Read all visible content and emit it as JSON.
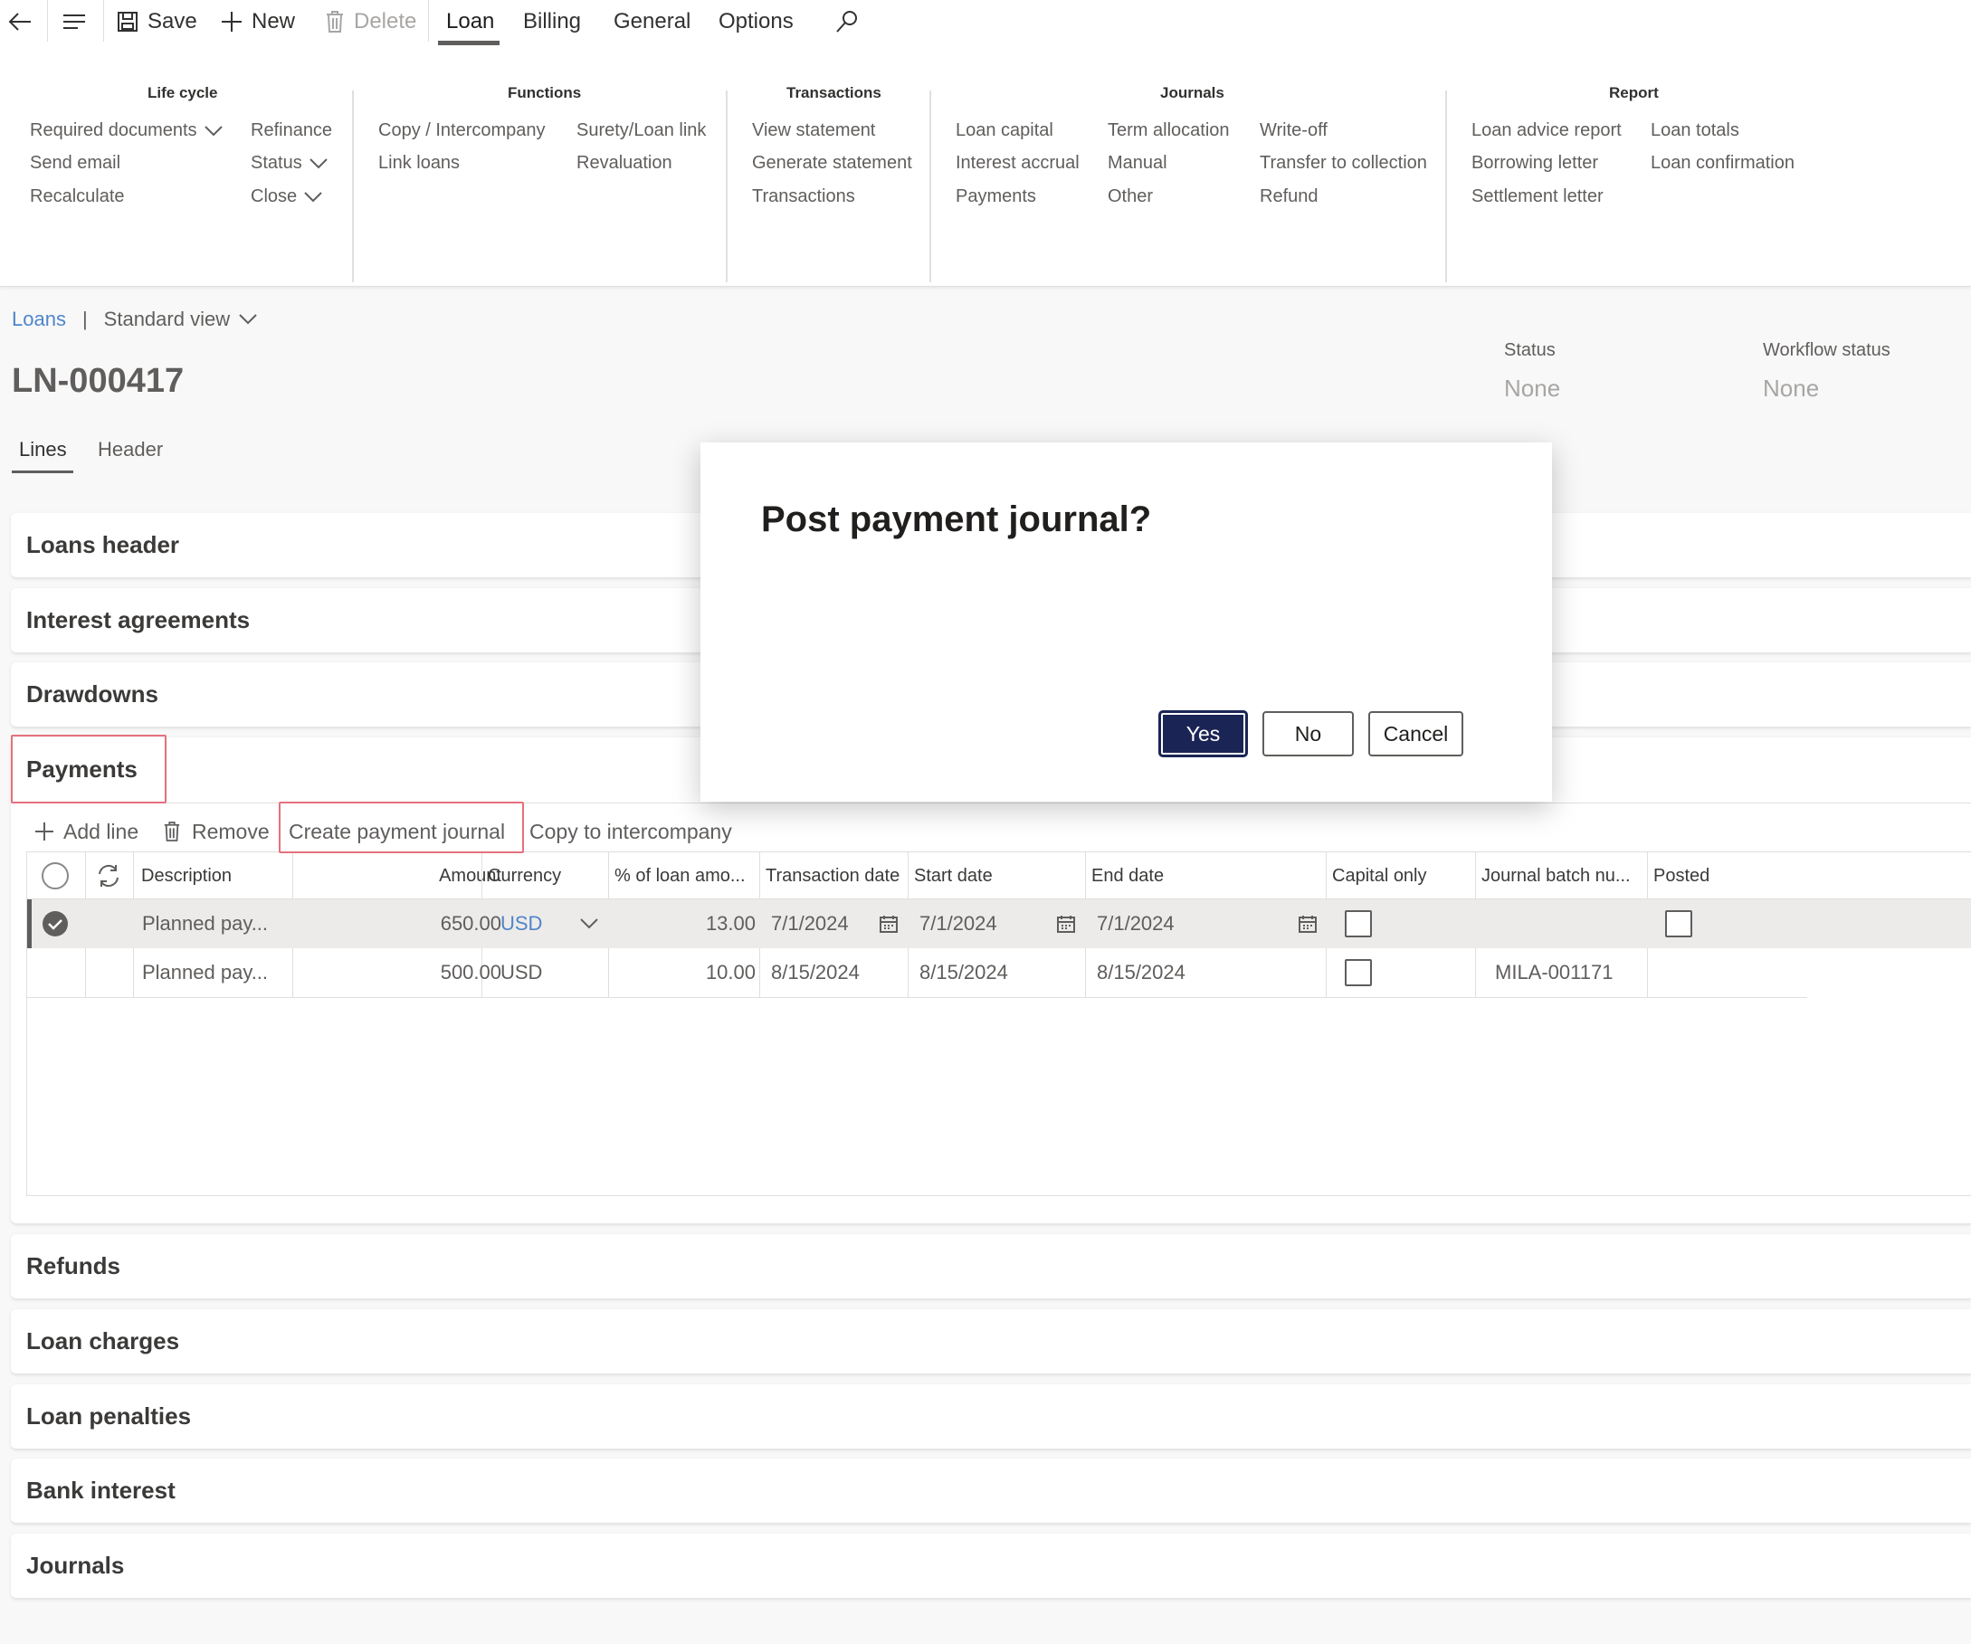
{
  "toolbar": {
    "save_label": "Save",
    "new_label": "New",
    "delete_label": "Delete",
    "tabs": [
      "Loan",
      "Billing",
      "General",
      "Options"
    ],
    "active_tab": "Loan"
  },
  "ribbon": {
    "groups": [
      {
        "title": "Life cycle",
        "items": [
          "Required documents",
          "Send email",
          "Recalculate",
          "Refinance",
          "Status",
          "Close"
        ]
      },
      {
        "title": "Functions",
        "items": [
          "Copy / Intercompany",
          "Link loans",
          "Surety/Loan link",
          "Revaluation"
        ]
      },
      {
        "title": "Transactions",
        "items": [
          "View statement",
          "Generate statement",
          "Transactions"
        ]
      },
      {
        "title": "Journals",
        "items": [
          "Loan capital",
          "Interest accrual",
          "Payments",
          "Term allocation",
          "Manual",
          "Other",
          "Write-off",
          "Transfer to collection",
          "Refund"
        ]
      },
      {
        "title": "Report",
        "items": [
          "Loan advice report",
          "Borrowing letter",
          "Settlement letter",
          "Loan totals",
          "Loan confirmation"
        ]
      }
    ]
  },
  "page": {
    "breadcrumb": "Loans",
    "separator": "|",
    "view": "Standard view",
    "record_id": "LN-000417",
    "tabs": [
      "Lines",
      "Header"
    ],
    "status_label": "Status",
    "status_value": "None",
    "workflow_label": "Workflow status",
    "workflow_value": "None"
  },
  "sections": {
    "loans_header": "Loans header",
    "interest_agreements": "Interest agreements",
    "drawdowns": "Drawdowns",
    "payments": "Payments",
    "refunds": "Refunds",
    "loan_charges": "Loan charges",
    "loan_penalties": "Loan penalties",
    "bank_interest": "Bank interest",
    "journals": "Journals"
  },
  "payments": {
    "actions": {
      "add_line": "Add line",
      "remove": "Remove",
      "create_journal": "Create payment journal",
      "copy_intercompany": "Copy to intercompany"
    },
    "columns": [
      "Description",
      "Amount",
      "Currency",
      "% of loan amo...",
      "Transaction date",
      "Start date",
      "End date",
      "Capital only",
      "Journal batch nu...",
      "Posted"
    ],
    "rows": [
      {
        "description": "Planned pay...",
        "amount": "650.00",
        "currency": "USD",
        "percent": "13.00",
        "transaction_date": "7/1/2024",
        "start_date": "7/1/2024",
        "end_date": "7/1/2024",
        "capital_only": false,
        "journal_batch": "",
        "posted": false,
        "selected": true
      },
      {
        "description": "Planned pay...",
        "amount": "500.00",
        "currency": "USD",
        "percent": "10.00",
        "transaction_date": "8/15/2024",
        "start_date": "8/15/2024",
        "end_date": "8/15/2024",
        "capital_only": false,
        "journal_batch": "MILA-001171",
        "posted": null,
        "selected": false
      }
    ]
  },
  "dialog": {
    "title": "Post payment journal?",
    "yes": "Yes",
    "no": "No",
    "cancel": "Cancel"
  },
  "colors": {
    "accent": "#1b2555",
    "link": "#4f85c9",
    "highlight": "#e5717d",
    "selected_row": "#edebe9"
  },
  "icons": [
    "back-arrow-icon",
    "hamburger-icon",
    "save-icon",
    "plus-icon",
    "trash-icon",
    "search-icon",
    "chevron-down-icon",
    "refresh-icon",
    "calendar-icon",
    "check-circle-icon"
  ]
}
